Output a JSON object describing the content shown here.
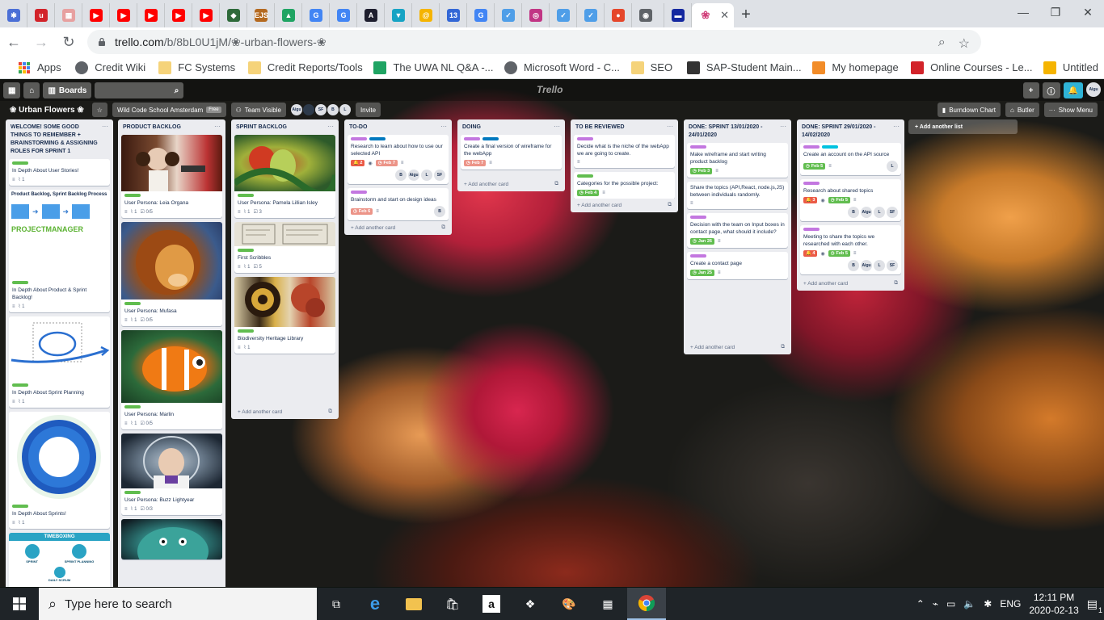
{
  "browser": {
    "tabs": [
      {
        "letter": "✱",
        "color": "#4b6fd6"
      },
      {
        "letter": "u",
        "color": "#d2232a"
      },
      {
        "letter": "▦",
        "color": "#e7a0a0"
      },
      {
        "letter": "▶",
        "color": "#ff0000"
      },
      {
        "letter": "▶",
        "color": "#ff0000"
      },
      {
        "letter": "▶",
        "color": "#ff0000"
      },
      {
        "letter": "▶",
        "color": "#ff0000"
      },
      {
        "letter": "▶",
        "color": "#ff0000"
      },
      {
        "letter": "◆",
        "color": "#2e6a3a"
      },
      {
        "letter": "EJS",
        "color": "#b4691f"
      },
      {
        "letter": "▲",
        "color": "#1fa463"
      },
      {
        "letter": "G",
        "color": "#4285f4"
      },
      {
        "letter": "G",
        "color": "#4285f4"
      },
      {
        "letter": "A",
        "color": "#1e1e2e"
      },
      {
        "letter": "▼",
        "color": "#16a3c4"
      },
      {
        "letter": "@",
        "color": "#f5b400"
      },
      {
        "letter": "13",
        "color": "#3367d6"
      },
      {
        "letter": "G",
        "color": "#4285f4"
      },
      {
        "letter": "✓",
        "color": "#4f9ee8"
      },
      {
        "letter": "◎",
        "color": "#c13584"
      },
      {
        "letter": "✓",
        "color": "#4f9ee8"
      },
      {
        "letter": "✓",
        "color": "#4f9ee8"
      },
      {
        "letter": "●",
        "color": "#e5462a"
      },
      {
        "letter": "◉",
        "color": "#5f6368"
      },
      {
        "letter": "▬",
        "color": "#1428a0"
      }
    ],
    "active_tab_icon": "❀",
    "url_host": "trello.com",
    "url_path": "/b/8bL0U1jM/❀-urban-flowers-❀",
    "profile_letter": "A",
    "bookmarks": [
      {
        "label": "Apps",
        "color": "#ea4335"
      },
      {
        "label": "Credit Wiki",
        "color": "#5f6368"
      },
      {
        "label": "FC Systems",
        "color": "#f5d37a"
      },
      {
        "label": "Credit Reports/Tools",
        "color": "#f5d37a"
      },
      {
        "label": "The UWA NL Q&A -...",
        "color": "#1fa463"
      },
      {
        "label": "Microsoft Word - C...",
        "color": "#5f6368"
      },
      {
        "label": "SEO",
        "color": "#f5d37a"
      },
      {
        "label": "SAP-Student Main...",
        "color": "#333333"
      },
      {
        "label": "My homepage",
        "color": "#f28c28"
      },
      {
        "label": "Online Courses - Le...",
        "color": "#d2232a"
      },
      {
        "label": "Untitled",
        "color": "#f5b400"
      }
    ]
  },
  "trello": {
    "boards_label": "Boards",
    "logo": "Trello",
    "board_title": "❀ Urban Flowers ❀",
    "team": "Wild Code School Amsterdam",
    "free": "Free",
    "visibility": "Team Visible",
    "members": [
      "Aigu",
      "",
      "SF",
      "B",
      "L"
    ],
    "invite": "Invite",
    "burndown": "Burndown Chart",
    "butler": "Butler",
    "show_menu": "Show Menu",
    "header_avatar": "Aigu",
    "add_list": "+ Add another list",
    "add_card": "+ Add another card",
    "lists": [
      {
        "title": "WELCOME! SOME GOOD THINGS TO REMEMBER + BRAINSTORMING & ASSIGNING ROLES for SPRINT 1",
        "cards": [
          {
            "title": "In Depth About User Stories!",
            "attach": "1"
          },
          {
            "title": "In Depth About Product & Sprint Backlog!",
            "attach": "1",
            "image": "pbsb",
            "img_head": "Product Backlog, Sprint Backlog Process",
            "img_brand": "PROJECTMANAGER"
          },
          {
            "title": "In Depth About Sprint Planning",
            "attach": "1",
            "image": "planning"
          },
          {
            "title": "In Depth About Sprints!",
            "attach": "1",
            "image": "cycle"
          },
          {
            "title": "",
            "image": "timeboxing",
            "img_head": "TIMEBOXING",
            "img_a": "SPRINT",
            "img_b": "SPRINT PLANNING",
            "img_c": "DAILY SCRUM"
          }
        ]
      },
      {
        "title": "PRODUCT BACKLOG",
        "cards": [
          {
            "title": "User Persona: Leia Organa",
            "attach": "1",
            "check": "0/5",
            "image": "leia"
          },
          {
            "title": "User Persona: Mufasa",
            "attach": "1",
            "check": "0/5",
            "image": "mufasa"
          },
          {
            "title": "User Persona: Marlin",
            "attach": "1",
            "check": "0/5",
            "image": "marlin"
          },
          {
            "title": "User Persona: Buzz Lightyear",
            "attach": "1",
            "check": "0/3",
            "image": "buzz"
          },
          {
            "title": "",
            "image": "sulley"
          }
        ]
      },
      {
        "title": "SPRINT BACKLOG",
        "cards": [
          {
            "title": "User Persona: Pamela Lillian Isley",
            "attach": "1",
            "check": "3",
            "image": "ivy"
          },
          {
            "title": "First Scribbles",
            "attach": "1",
            "check": "5",
            "image": "sketch"
          },
          {
            "title": "Biodiversity Heritage Library",
            "attach": "1",
            "image": "botany"
          }
        ]
      },
      {
        "title": "TO-DO",
        "cards": [
          {
            "title": "Research to learn about how to use our selected API",
            "count": "2",
            "due": "Feb 7",
            "members": [
              "B",
              "Aigu",
              "L",
              "SF"
            ]
          },
          {
            "title": "Brainstorm and start on design ideas",
            "due": "Feb 6",
            "members": [
              "B"
            ]
          }
        ]
      },
      {
        "title": "DOING",
        "cards": [
          {
            "title": "Create a final version of wireframe for the webApp",
            "due": "Feb 7"
          }
        ]
      },
      {
        "title": "TO BE REVIEWED",
        "cards": [
          {
            "title": "Decide what is the niche of the webApp we are going to create."
          },
          {
            "title": "Categories for the possible project:",
            "due": "Feb 4"
          }
        ]
      },
      {
        "title": "DONE: SPRINT 13/01/2020 - 24/01/2020",
        "cards": [
          {
            "title": "Make wireframe and start writing product backlog",
            "due": "Feb 3"
          },
          {
            "title": "Share the topics (API,React, node.js,JS) between individuals randomly."
          },
          {
            "title": "Decision with the team on Input boxes in contact page, what should it include?",
            "due": "Jan 26"
          },
          {
            "title": "Create a contact page",
            "due": "Jan 25"
          }
        ]
      },
      {
        "title": "DONE: SPRINT 29/01/2020 - 14/02/2020",
        "cards": [
          {
            "title": "Create an account on the API source",
            "due": "Feb 5",
            "members": [
              "L"
            ]
          },
          {
            "title": "Research about shared topics",
            "count": "3",
            "due": "Feb 5",
            "members": [
              "B",
              "Aigu",
              "L",
              "SF"
            ]
          },
          {
            "title": "Meeting to share the topics we researched with each other.",
            "count": "4",
            "due": "Feb 5",
            "members": [
              "B",
              "Aigu",
              "L",
              "SF"
            ]
          }
        ]
      }
    ]
  },
  "taskbar": {
    "search_placeholder": "Type here to search",
    "lang": "ENG",
    "time": "12:11 PM",
    "date": "2020-02-13",
    "notif": "1"
  }
}
